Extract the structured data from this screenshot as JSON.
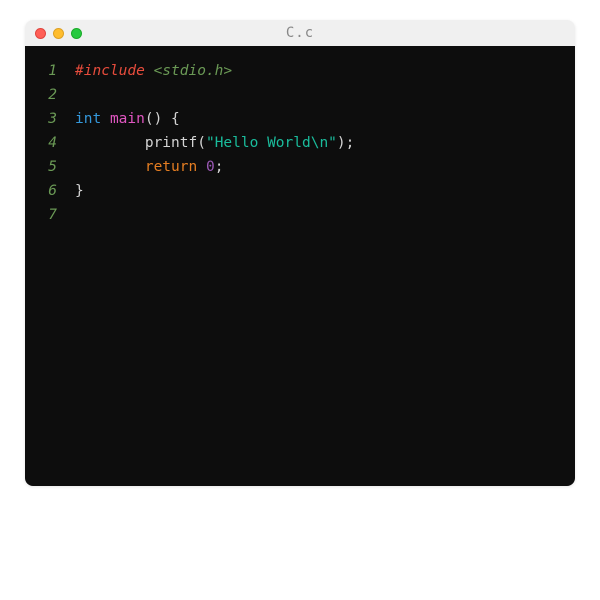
{
  "window": {
    "title": "C.c"
  },
  "editor": {
    "lines": [
      {
        "num": "1",
        "tokens": [
          {
            "cls": "tok-preproc",
            "text": "#include"
          },
          {
            "cls": "tok-punct",
            "text": " "
          },
          {
            "cls": "tok-sysheader",
            "text": "<stdio.h>"
          }
        ]
      },
      {
        "num": "2",
        "tokens": []
      },
      {
        "num": "3",
        "tokens": [
          {
            "cls": "tok-keyword",
            "text": "int"
          },
          {
            "cls": "tok-punct",
            "text": " "
          },
          {
            "cls": "tok-funcname",
            "text": "main"
          },
          {
            "cls": "tok-punct",
            "text": "() {"
          }
        ]
      },
      {
        "num": "4",
        "tokens": [
          {
            "cls": "tok-punct",
            "text": "        "
          },
          {
            "cls": "tok-ident",
            "text": "printf"
          },
          {
            "cls": "tok-punct",
            "text": "("
          },
          {
            "cls": "tok-string",
            "text": "\"Hello World\\n\""
          },
          {
            "cls": "tok-punct",
            "text": ");"
          }
        ]
      },
      {
        "num": "5",
        "tokens": [
          {
            "cls": "tok-punct",
            "text": "        "
          },
          {
            "cls": "tok-return",
            "text": "return"
          },
          {
            "cls": "tok-punct",
            "text": " "
          },
          {
            "cls": "tok-number",
            "text": "0"
          },
          {
            "cls": "tok-punct",
            "text": ";"
          }
        ]
      },
      {
        "num": "6",
        "tokens": [
          {
            "cls": "tok-punct",
            "text": "}"
          }
        ]
      },
      {
        "num": "7",
        "tokens": []
      }
    ]
  }
}
